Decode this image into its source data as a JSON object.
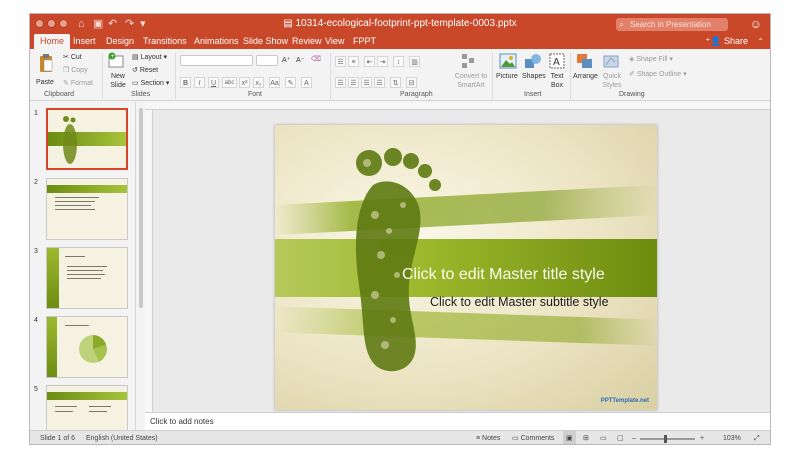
{
  "window": {
    "title": "10314-ecological-footprint-ppt-template-0003.pptx"
  },
  "search": {
    "placeholder": "Search in Presentation"
  },
  "tabs": [
    "Home",
    "Insert",
    "Design",
    "Transitions",
    "Animations",
    "Slide Show",
    "Review",
    "View",
    "FPPT"
  ],
  "share_label": "Share",
  "ribbon": {
    "paste": "Paste",
    "cut": "Cut",
    "copy": "Copy",
    "format": "Format",
    "new_slide": "New\nSlide",
    "layout": "Layout",
    "reset": "Reset",
    "section": "Section",
    "convert_smartart": "Convert to\nSmartArt",
    "picture": "Picture",
    "shapes": "Shapes",
    "text_box": "Text\nBox",
    "arrange": "Arrange",
    "quick_styles": "Quick\nStyles",
    "shape_fill": "Shape Fill",
    "shape_outline": "Shape Outline",
    "groups": {
      "clipboard": "Clipboard",
      "slides": "Slides",
      "font": "Font",
      "paragraph": "Paragraph",
      "insert": "Insert",
      "drawing": "Drawing"
    }
  },
  "thumbnails": [
    {
      "number": "1",
      "selected": true
    },
    {
      "number": "2",
      "selected": false
    },
    {
      "number": "3",
      "selected": false
    },
    {
      "number": "4",
      "selected": false
    },
    {
      "number": "5",
      "selected": false
    }
  ],
  "slide": {
    "title": "Click to edit Master title style",
    "subtitle": "Click to edit Master subtitle style",
    "brand": "PPTTemplate.net"
  },
  "notes_placeholder": "Click to add notes",
  "status": {
    "slide_position": "Slide 1 of 6",
    "language": "English (United States)",
    "notes": "Notes",
    "comments": "Comments",
    "zoom": "103%"
  },
  "colors": {
    "accent": "#c9482a",
    "slide_green": "#8aa922",
    "brand_blue": "#2a6db4"
  }
}
